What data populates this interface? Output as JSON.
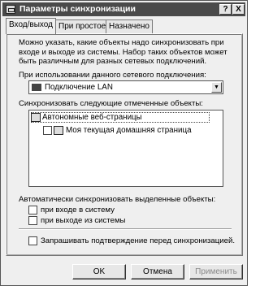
{
  "window": {
    "title": "Параметры синхронизации",
    "help_btn": "?",
    "close_btn": "X"
  },
  "tabs": [
    {
      "label": "Вход/выход",
      "active": true
    },
    {
      "label": "При простое",
      "active": false
    },
    {
      "label": "Назначено",
      "active": false
    }
  ],
  "intro_text": "Можно указать, какие объекты надо синхронизовать при входе и выходе из системы.  Набор таких объектов может быть различным для разных сетевых подключений.",
  "connection": {
    "label": "При использовании данного сетевого подключения:",
    "selected": "Подключение LAN",
    "icon": "network-icon"
  },
  "sync_items": {
    "label": "Синхронизовать следующие отмеченные объекты:",
    "items": [
      {
        "label": "Автономные веб-страницы",
        "icon": "offline-pages-icon",
        "checked": true,
        "level": 0
      },
      {
        "label": "Моя текущая домашняя страница",
        "icon": "web-page-icon",
        "checked": false,
        "level": 1
      }
    ]
  },
  "auto_sync": {
    "label": "Автоматически синхронизовать выделенные объекты:",
    "options": [
      {
        "label": "при входе в систему",
        "checked": false
      },
      {
        "label": "при выходе из системы",
        "checked": false
      }
    ]
  },
  "confirm": {
    "label": "Запрашивать подтверждение перед синхронизацией.",
    "checked": false
  },
  "buttons": {
    "ok": "OK",
    "cancel": "Отмена",
    "apply": "Применить"
  }
}
